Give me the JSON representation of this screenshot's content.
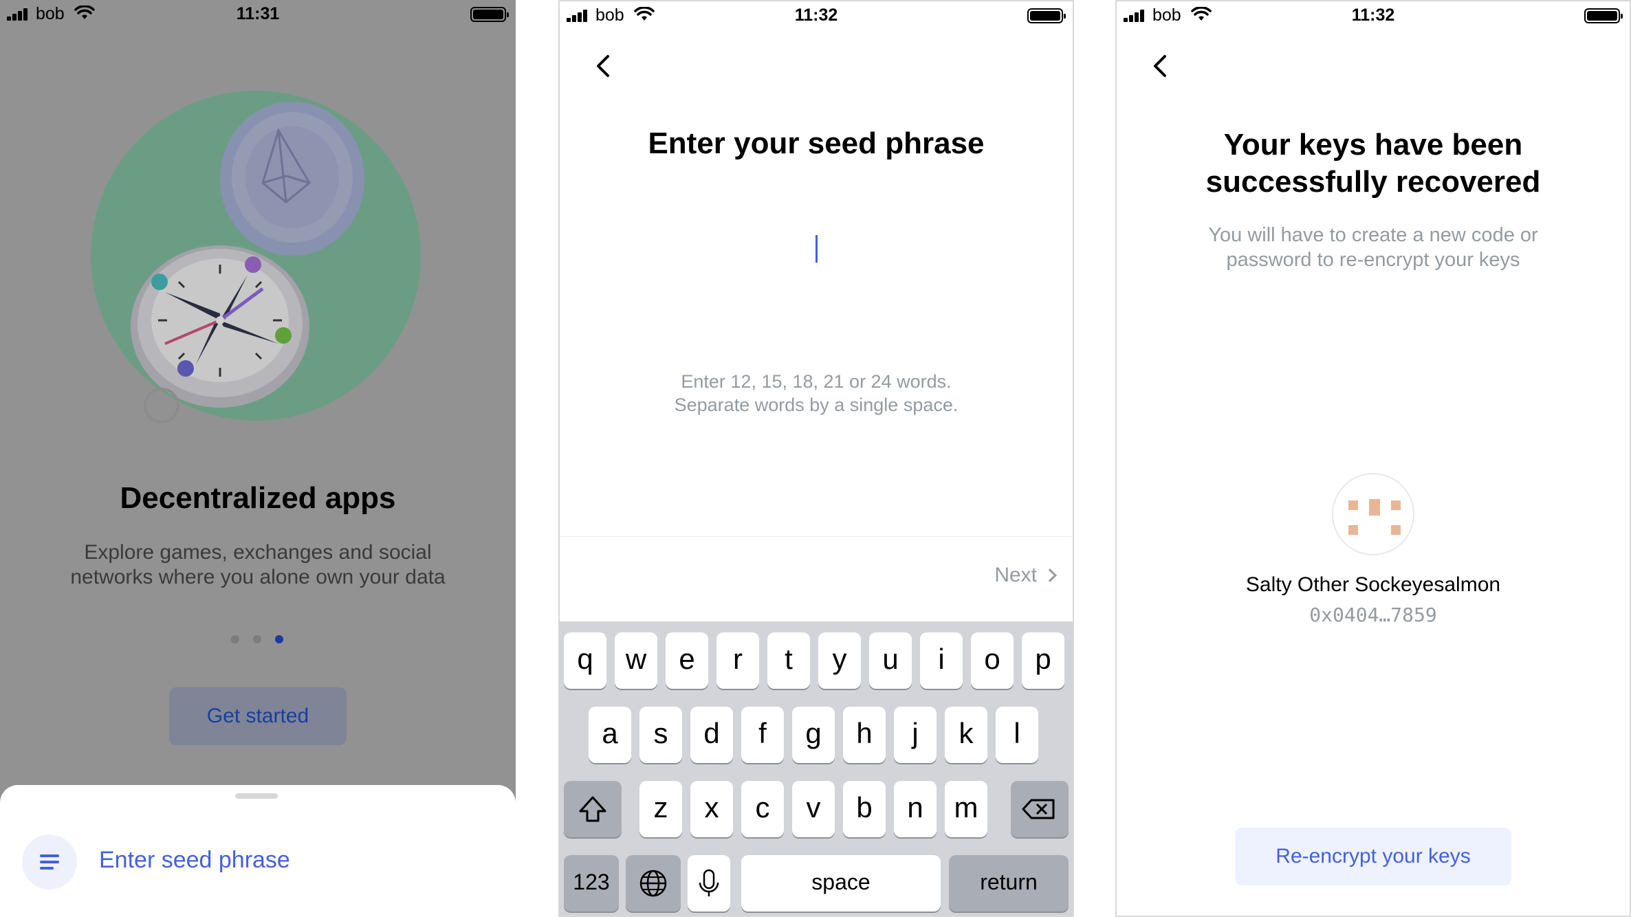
{
  "screens": {
    "welcome": {
      "status": {
        "carrier": "bob",
        "time": "11:31"
      },
      "title": "Decentralized apps",
      "description": "Explore games, exchanges and social networks where you alone own your data",
      "pager": {
        "count": 3,
        "active_index": 2
      },
      "get_started_label": "Get started",
      "sheet": {
        "option_label": "Enter seed phrase",
        "option_icon": "list-icon"
      }
    },
    "seed_phrase": {
      "status": {
        "carrier": "bob",
        "time": "11:32"
      },
      "title": "Enter your seed phrase",
      "hint_line1": "Enter 12, 15, 18, 21 or 24 words.",
      "hint_line2": "Separate words by a single space.",
      "next_label": "Next",
      "keyboard": {
        "row1": [
          "q",
          "w",
          "e",
          "r",
          "t",
          "y",
          "u",
          "i",
          "o",
          "p"
        ],
        "row2": [
          "a",
          "s",
          "d",
          "f",
          "g",
          "h",
          "j",
          "k",
          "l"
        ],
        "row3": [
          "z",
          "x",
          "c",
          "v",
          "b",
          "n",
          "m"
        ],
        "numbers_label": "123",
        "space_label": "space",
        "return_label": "return"
      }
    },
    "recovered": {
      "status": {
        "carrier": "bob",
        "time": "11:32"
      },
      "title": "Your keys have been successfully recovered",
      "description": "You will have to create a new code or password to re-encrypt your keys",
      "account_name": "Salty Other Sockeyesalmon",
      "account_address": "0x0404…7859",
      "reencrypt_label": "Re-encrypt your keys"
    }
  },
  "colors": {
    "accent": "#4360df",
    "muted_text": "#939ba1",
    "overlay_bg": "#929292",
    "keyboard_bg": "#d2d4da",
    "avatar_tile": "#e8b696"
  }
}
